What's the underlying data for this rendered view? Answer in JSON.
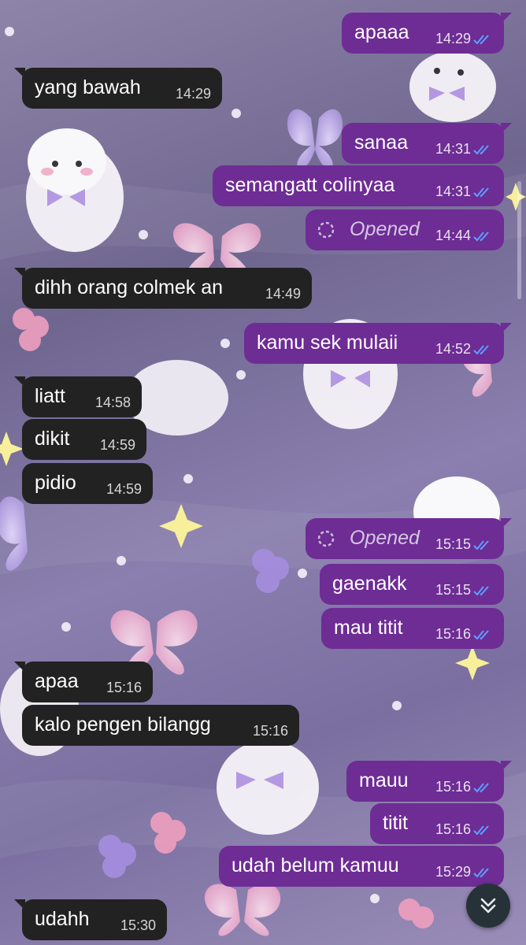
{
  "colors": {
    "outgoing_bubble": "#6e2c95",
    "incoming_bubble": "#222222",
    "read_ticks": "#5ea0ff",
    "scroll_button": "#263238"
  },
  "icons": {
    "read_receipt": "double-check-icon",
    "opened": "opened-dashed-circle-icon",
    "scroll_down": "chevron-double-down-icon"
  },
  "messages": [
    {
      "dir": "out",
      "text": "apaaa",
      "time": "14:29",
      "read": true
    },
    {
      "dir": "in",
      "text": "yang bawah",
      "time": "14:29"
    },
    {
      "dir": "out",
      "text": "sanaa",
      "time": "14:31",
      "read": true
    },
    {
      "dir": "out",
      "text": "semangatt colinyaa",
      "time": "14:31",
      "read": true
    },
    {
      "dir": "out",
      "text": "Opened",
      "time": "14:44",
      "read": true,
      "opened": true
    },
    {
      "dir": "in",
      "text": "dihh orang colmek an",
      "time": "14:49"
    },
    {
      "dir": "out",
      "text": "kamu sek mulaii",
      "time": "14:52",
      "read": true
    },
    {
      "dir": "in",
      "text": "liatt",
      "time": "14:58"
    },
    {
      "dir": "in",
      "text": "dikit",
      "time": "14:59"
    },
    {
      "dir": "in",
      "text": "pidio",
      "time": "14:59"
    },
    {
      "dir": "out",
      "text": "Opened",
      "time": "15:15",
      "read": true,
      "opened": true
    },
    {
      "dir": "out",
      "text": "gaenakk",
      "time": "15:15",
      "read": true
    },
    {
      "dir": "out",
      "text": "mau titit",
      "time": "15:16",
      "read": true
    },
    {
      "dir": "in",
      "text": "apaa",
      "time": "15:16"
    },
    {
      "dir": "in",
      "text": "kalo pengen bilangg",
      "time": "15:16"
    },
    {
      "dir": "out",
      "text": "mauu",
      "time": "15:16",
      "read": true
    },
    {
      "dir": "out",
      "text": "titit",
      "time": "15:16",
      "read": true
    },
    {
      "dir": "out",
      "text": "udah belum kamuu",
      "time": "15:29",
      "read": true
    },
    {
      "dir": "in",
      "text": "udahh",
      "time": "15:30"
    }
  ]
}
